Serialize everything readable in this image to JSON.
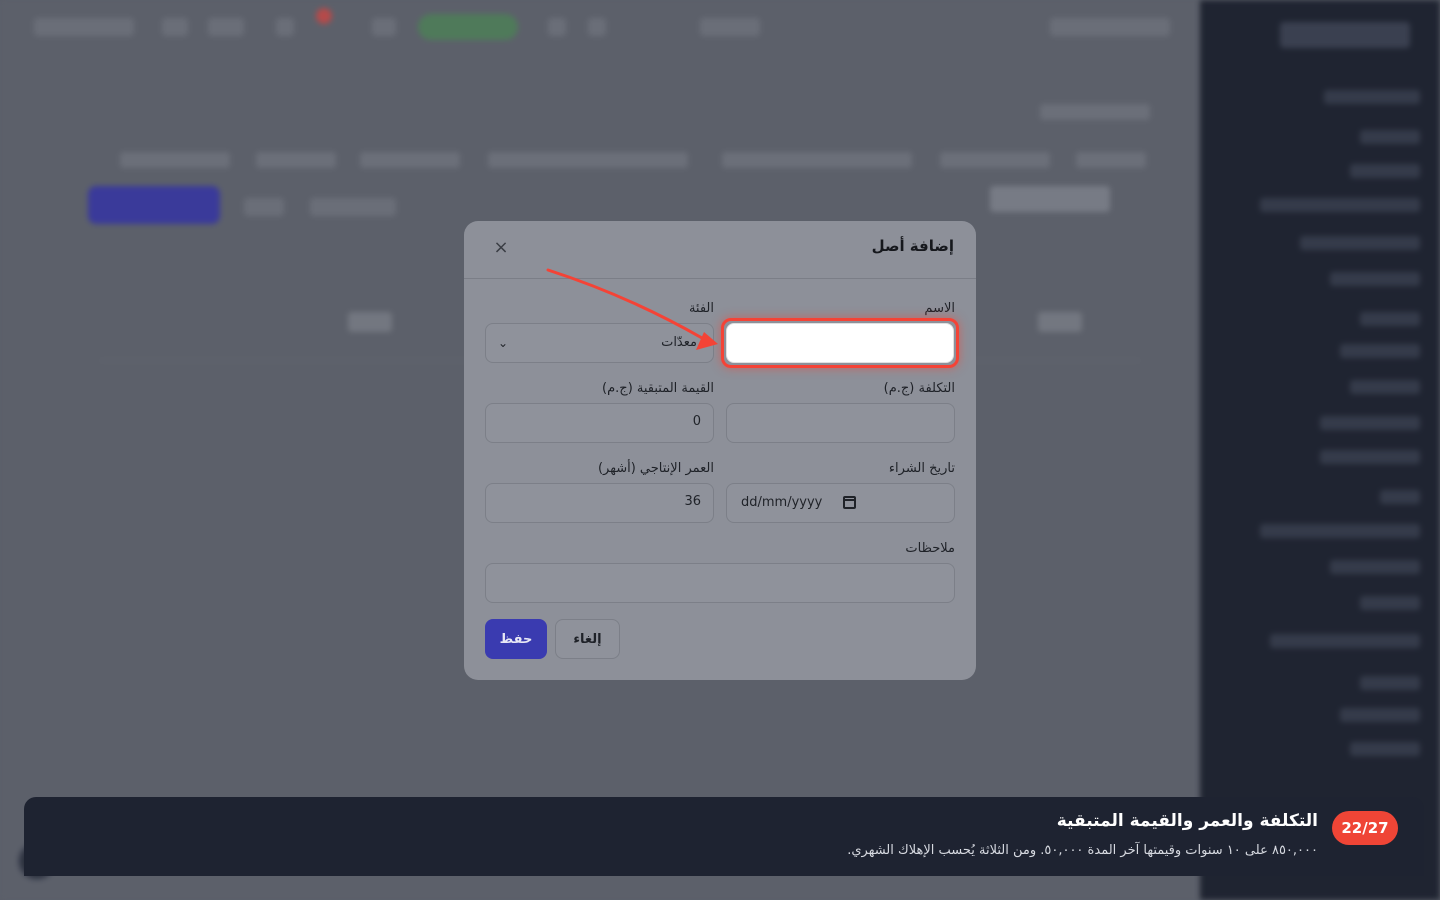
{
  "modal": {
    "title": "إضافة أصل",
    "close_icon": "×",
    "fields": {
      "name_label": "الاسم",
      "name_value": "",
      "category_label": "الفئة",
      "category_value": "معدّات",
      "cost_label": "التكلفة (ج.م)",
      "cost_value": "",
      "salvage_label": "القيمة المتبقية (ج.م)",
      "salvage_value": "0",
      "purchase_date_label": "تاريخ الشراء",
      "purchase_date_placeholder": "dd/mm/yyyy",
      "useful_life_label": "العمر الإنتاجي (أشهر)",
      "useful_life_value": "36",
      "notes_label": "ملاحظات",
      "notes_value": ""
    },
    "buttons": {
      "save": "حفظ",
      "cancel": "إلغاء"
    }
  },
  "tour": {
    "step": "22/27",
    "title": "التكلفة والعمر والقيمة المتبقية",
    "description": "٨٥٠,٠٠٠ على ١٠ سنوات وقيمتها آخر المدة ٥٠,٠٠٠. ومن الثلاثة يُحسب الإهلاك الشهري."
  },
  "colors": {
    "accent": "#3a3bb0",
    "highlight": "#f44336",
    "badge": "#ef4536"
  }
}
